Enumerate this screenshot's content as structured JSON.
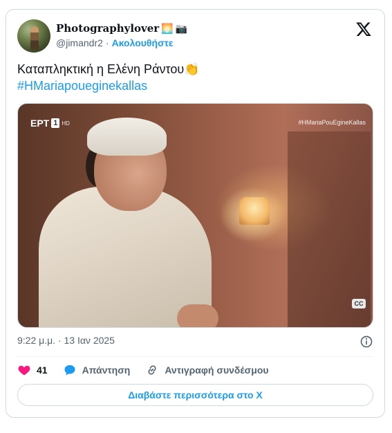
{
  "author": {
    "display_name": "Photographylover",
    "emojis": [
      "🌅",
      "📷"
    ],
    "handle": "@jimandr2",
    "separator": "·",
    "follow_label": "Ακολουθήστε"
  },
  "tweet": {
    "text": "Καταπληκτική η Ελένη Ράντου",
    "text_emoji": "👏",
    "hashtag": "#HMariapoueginekallas"
  },
  "media": {
    "channel_logo": "ΕΡΤ",
    "channel_number": "1",
    "channel_hd": "HD",
    "overlay_hashtag": "#HMariaPouEgineKallas",
    "cc_label": "CC"
  },
  "meta": {
    "timestamp": "9:22 μ.μ. · 13 Ιαν 2025"
  },
  "actions": {
    "like_count": "41",
    "reply_label": "Απάντηση",
    "copy_link_label": "Αντιγραφή συνδέσμου"
  },
  "read_more_label": "Διαβάστε περισσότερα στο X",
  "colors": {
    "accent": "#1d9bf0",
    "like": "#f91880",
    "muted": "#536471",
    "border": "#cfd9de"
  },
  "icons": [
    "x-logo-icon",
    "info-icon",
    "heart-icon",
    "reply-bubble-icon",
    "link-icon"
  ]
}
